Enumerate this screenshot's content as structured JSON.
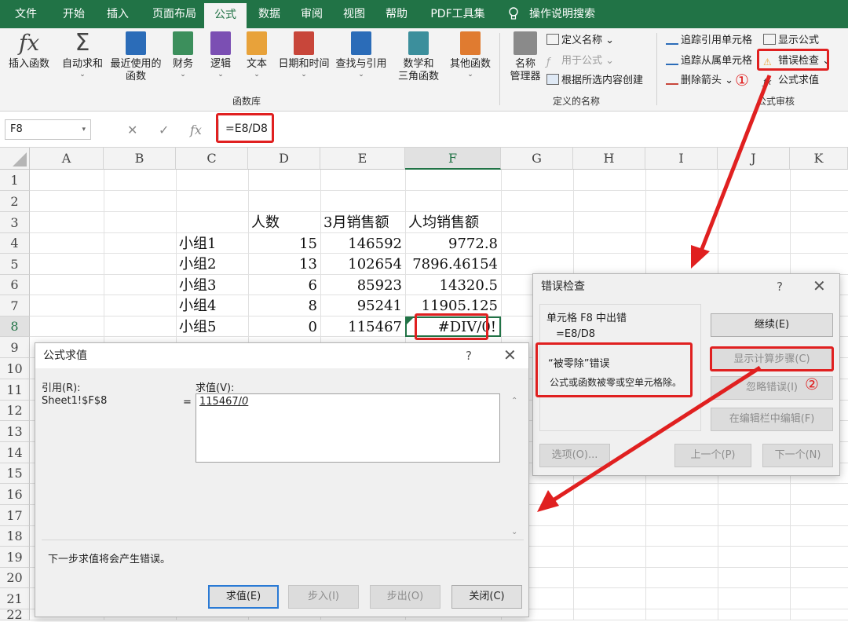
{
  "menu": {
    "tabs": [
      "文件",
      "开始",
      "插入",
      "页面布局",
      "公式",
      "数据",
      "审阅",
      "视图",
      "帮助",
      "PDF工具集"
    ],
    "active_tab": "公式",
    "search": "操作说明搜索"
  },
  "ribbon": {
    "insert_function": "插入函数",
    "autosum": "自动求和",
    "recent_line1": "最近使用的",
    "recent_line2": "函数",
    "financial": "财务",
    "logical": "逻辑",
    "text": "文本",
    "datetime": "日期和时间",
    "lookup": "查找与引用",
    "math_line1": "数学和",
    "math_line2": "三角函数",
    "more": "其他函数",
    "library_group": "函数库",
    "name_mgr_line1": "名称",
    "name_mgr_line2": "管理器",
    "define_name": "定义名称",
    "use_in_formula": "用于公式",
    "create_from_sel": "根据所选内容创建",
    "names_group": "定义的名称",
    "trace_precedents": "追踪引用单元格",
    "trace_dependents": "追踪从属单元格",
    "remove_arrows": "删除箭头",
    "show_formulas": "显示公式",
    "error_checking": "错误检查",
    "evaluate_formula": "公式求值",
    "audit_group": "公式审核",
    "icon_fx": "fx",
    "icon_sigma": "Σ",
    "marker1": "①"
  },
  "formula_bar": {
    "name_box": "F8",
    "formula": "=E8/D8",
    "fx": "fx"
  },
  "sheet": {
    "columns": [
      "A",
      "B",
      "C",
      "D",
      "E",
      "F",
      "G",
      "H",
      "I",
      "J",
      "K"
    ],
    "rows": [
      "1",
      "2",
      "3",
      "4",
      "5",
      "6",
      "7",
      "8",
      "9",
      "10",
      "11",
      "12",
      "13",
      "14",
      "15",
      "16",
      "17",
      "18",
      "19",
      "20",
      "21",
      "22"
    ],
    "header_row": {
      "D": "人数",
      "E": "3月销售额",
      "F": "人均销售额"
    },
    "data": [
      {
        "C": "小组1",
        "D": "15",
        "E": "146592",
        "F": "9772.8"
      },
      {
        "C": "小组2",
        "D": "13",
        "E": "102654",
        "F": "7896.46154"
      },
      {
        "C": "小组3",
        "D": "6",
        "E": "85923",
        "F": "14320.5"
      },
      {
        "C": "小组4",
        "D": "8",
        "E": "95241",
        "F": "11905.125"
      },
      {
        "C": "小组5",
        "D": "0",
        "E": "115467",
        "F": "#DIV/0!"
      }
    ]
  },
  "error_dialog": {
    "title": "错误检查",
    "help": "?",
    "close": "✕",
    "cell_error": "单元格 F8 中出错",
    "formula": "=E8/D8",
    "error_type": "“被零除”错误",
    "error_desc": "公式或函数被零或空单元格除。",
    "btn_continue": "继续(E)",
    "btn_show_steps": "显示计算步骤(C)",
    "btn_ignore": "忽略错误(I)",
    "btn_edit": "在编辑栏中编辑(F)",
    "btn_options": "选项(O)...",
    "btn_prev": "上一个(P)",
    "btn_next": "下一个(N)",
    "marker2": "②"
  },
  "eval_dialog": {
    "title": "公式求值",
    "help": "?",
    "close": "✕",
    "ref_label": "引用(R):",
    "ref_value": "Sheet1!$F$8",
    "eq": "=",
    "eval_label": "求值(V):",
    "eval_value": "115467/",
    "eval_italic": "0",
    "status": "下一步求值将会产生错误。",
    "btn_evaluate": "求值(E)",
    "btn_step_in": "步入(I)",
    "btn_step_out": "步出(O)",
    "btn_close": "关闭(C)"
  },
  "colors": {
    "excel_green": "#217346",
    "highlight_red": "#e02020"
  }
}
